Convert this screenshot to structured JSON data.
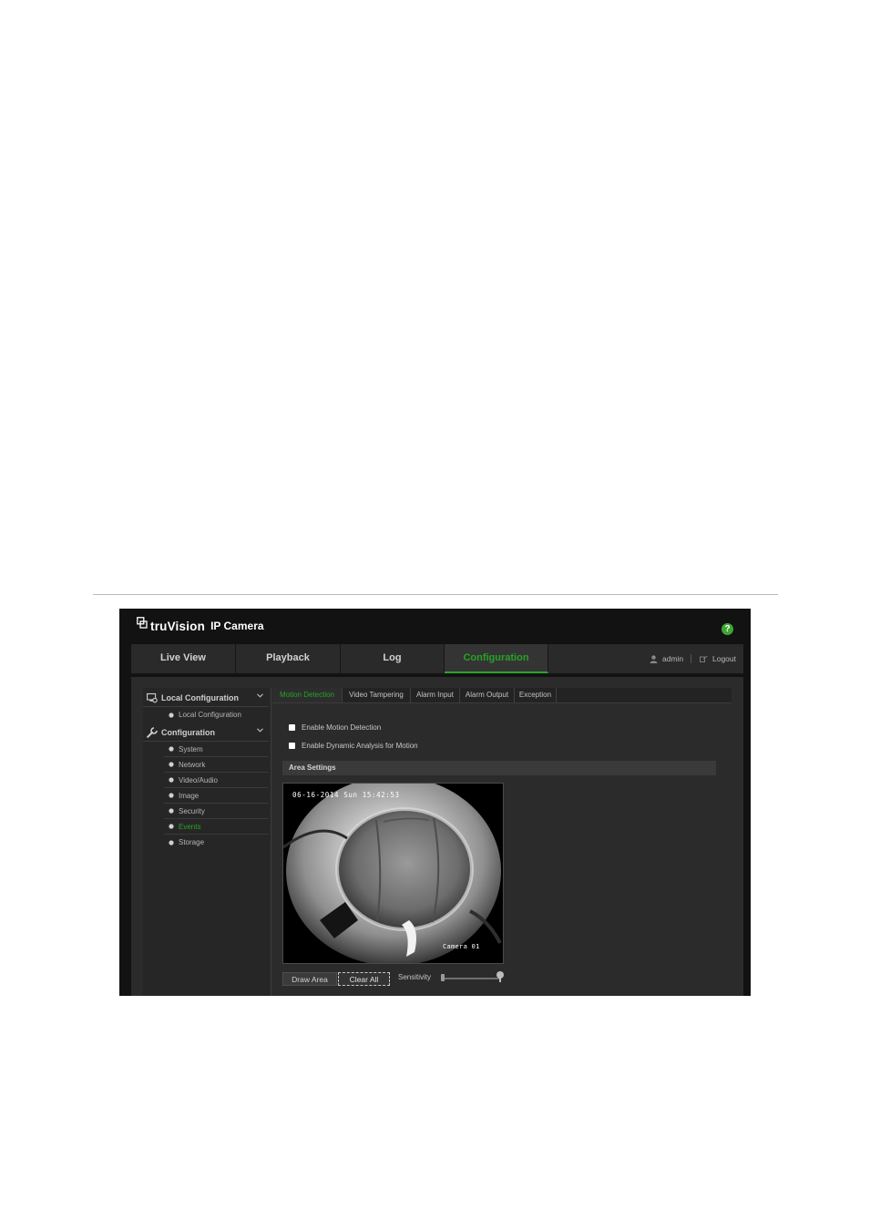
{
  "app": {
    "brand_name": "truVision",
    "brand_sub": "IP Camera",
    "help_symbol": "?"
  },
  "nav": {
    "tabs": [
      {
        "label": "Live View"
      },
      {
        "label": "Playback"
      },
      {
        "label": "Log"
      },
      {
        "label": "Configuration",
        "active": true
      }
    ],
    "user": "admin",
    "logout": "Logout"
  },
  "sidebar": {
    "local_section": "Local Configuration",
    "local_items": [
      "Local Configuration"
    ],
    "config_section": "Configuration",
    "config_items": [
      "System",
      "Network",
      "Video/Audio",
      "Image",
      "Security",
      "Events",
      "Storage"
    ],
    "active_item": "Events"
  },
  "subtabs": [
    "Motion Detection",
    "Video Tampering",
    "Alarm Input",
    "Alarm Output",
    "Exception"
  ],
  "motion": {
    "enable_motion": "Enable Motion Detection",
    "enable_dynamic": "Enable Dynamic Analysis for Motion",
    "area_settings": "Area Settings",
    "osd_time": "06-16-2014 Sun 15:42:53",
    "osd_camera": "Camera 01",
    "draw_area": "Draw Area",
    "clear_all": "Clear All",
    "sensitivity": "Sensitivity"
  },
  "colors": {
    "accent_green": "#26a326",
    "header_bg": "#121212",
    "panel_bg": "#2b2b2b"
  },
  "icons": {
    "brand": "truvision-logo-icon",
    "help": "help-icon",
    "user": "user-icon",
    "logout": "logout-icon",
    "local_config": "monitor-gear-icon",
    "configuration": "wrench-icon",
    "chevron": "chevron-down-icon",
    "bullet": "bullet-icon"
  }
}
